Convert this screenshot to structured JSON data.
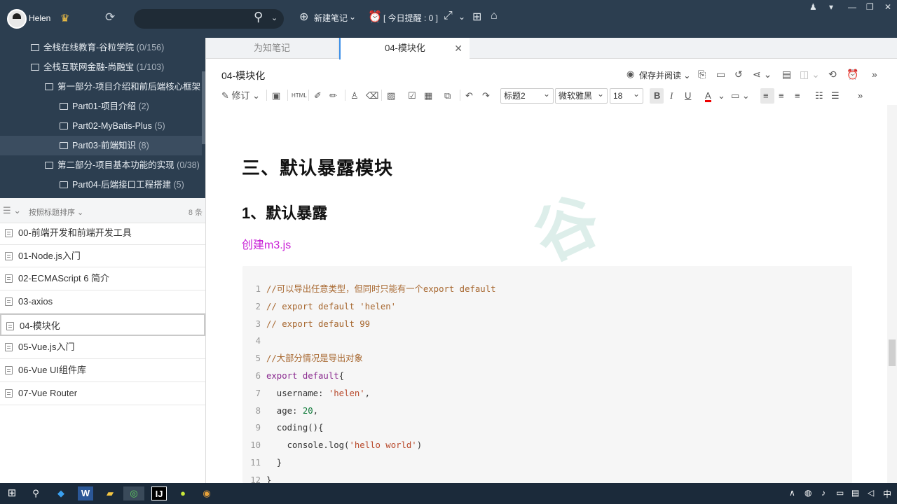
{
  "user": {
    "name": "Helen"
  },
  "toolbar": {
    "new_note": "新建笔记",
    "reminder": "[ 今日提醒 : 0 ]"
  },
  "tree": [
    {
      "label": "全栈在线教育-谷粒学院",
      "count": "(0/156)"
    },
    {
      "label": "全栈互联网金融-尚融宝",
      "count": "(1/103)"
    },
    {
      "label": "第一部分-项目介绍和前后端核心框架",
      "count": ""
    },
    {
      "label": "Part01-项目介绍",
      "count": "(2)"
    },
    {
      "label": "Part02-MyBatis-Plus",
      "count": "(5)"
    },
    {
      "label": "Part03-前端知识",
      "count": "(8)"
    },
    {
      "label": "第二部分-项目基本功能的实现",
      "count": "(0/38)"
    },
    {
      "label": "Part04-后端接口工程搭建",
      "count": "(5)"
    }
  ],
  "sort": {
    "label": "按照标题排序",
    "count": "8 条"
  },
  "notes": [
    "00-前端开发和前端开发工具",
    "01-Node.js入门",
    "02-ECMAScript 6 简介",
    "03-axios",
    "04-模块化",
    "05-Vue.js入门",
    "06-Vue UI组件库",
    "07-Vue Router"
  ],
  "tabs": [
    {
      "label": "为知笔记"
    },
    {
      "label": "04-模块化"
    }
  ],
  "doc": {
    "title": "04-模块化",
    "save_label": "保存并阅读",
    "revise_label": "修订",
    "style_select": "标题2",
    "font_select": "微软雅黑",
    "size_select": "18",
    "heading2": "三、默认暴露模块",
    "heading3": "1、默认暴露",
    "link": "创建m3.js"
  },
  "code": [
    {
      "n": "1",
      "parts": [
        {
          "c": "cm",
          "t": "//可以导出任意类型，但同时只能有一个export default"
        }
      ]
    },
    {
      "n": "2",
      "parts": [
        {
          "c": "cm",
          "t": "// export default 'helen'"
        }
      ]
    },
    {
      "n": "3",
      "parts": [
        {
          "c": "cm",
          "t": "// export default 99"
        }
      ]
    },
    {
      "n": "4",
      "parts": []
    },
    {
      "n": "5",
      "parts": [
        {
          "c": "cm",
          "t": "//大部分情况是导出对象"
        }
      ]
    },
    {
      "n": "6",
      "parts": [
        {
          "c": "kw",
          "t": "export default"
        },
        {
          "c": "pl",
          "t": "{"
        }
      ]
    },
    {
      "n": "7",
      "parts": [
        {
          "c": "pl",
          "t": "  username: "
        },
        {
          "c": "st",
          "t": "'helen'"
        },
        {
          "c": "pl",
          "t": ","
        }
      ]
    },
    {
      "n": "8",
      "parts": [
        {
          "c": "pl",
          "t": "  age: "
        },
        {
          "c": "nm",
          "t": "20"
        },
        {
          "c": "pl",
          "t": ","
        }
      ]
    },
    {
      "n": "9",
      "parts": [
        {
          "c": "pl",
          "t": "  coding(){"
        }
      ]
    },
    {
      "n": "10",
      "parts": [
        {
          "c": "pl",
          "t": "    console.log("
        },
        {
          "c": "st",
          "t": "'hello world'"
        },
        {
          "c": "pl",
          "t": ")"
        }
      ]
    },
    {
      "n": "11",
      "parts": [
        {
          "c": "pl",
          "t": "  }"
        }
      ]
    },
    {
      "n": "12",
      "parts": [
        {
          "c": "pl",
          "t": "}"
        }
      ]
    }
  ],
  "taskbar": {
    "ime": "中"
  },
  "colors": {
    "sidebar": "#2c3e50",
    "link": "#c81ed6",
    "accent": "#3b8fe8"
  }
}
